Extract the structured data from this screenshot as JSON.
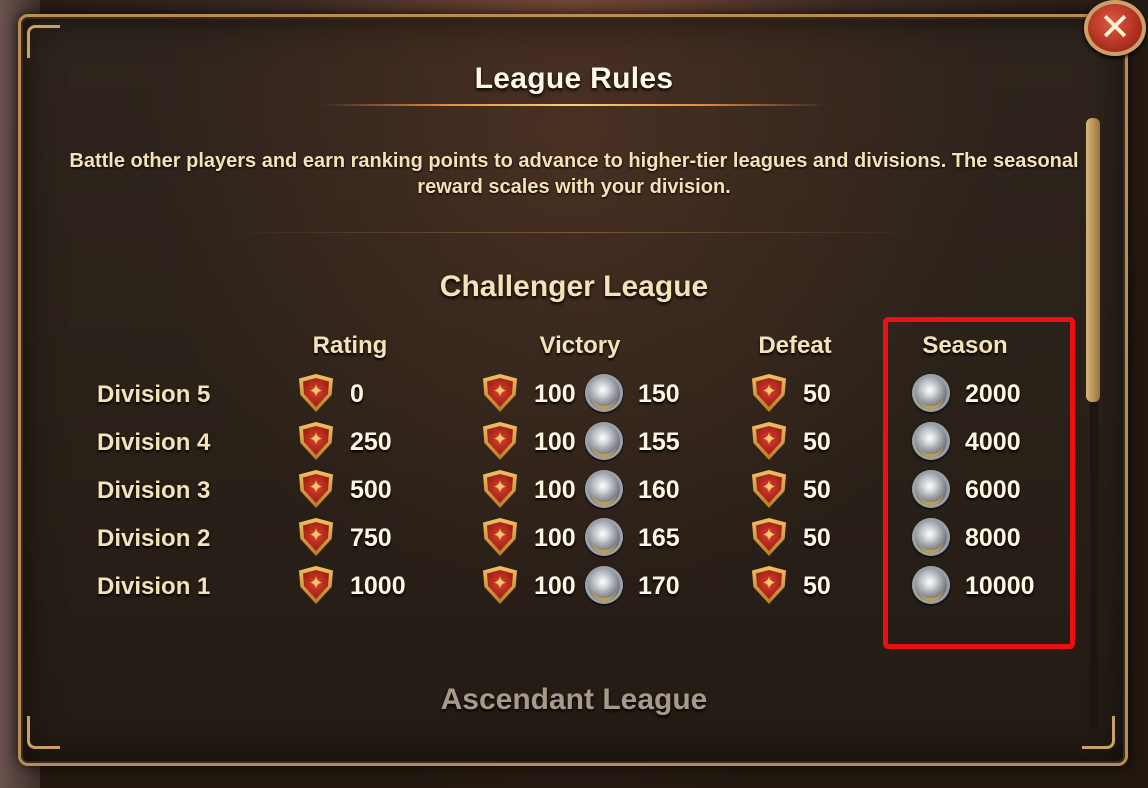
{
  "dialog": {
    "title": "League Rules",
    "description": "Battle other players and earn ranking points to advance to higher-tier leagues and divisions. The seasonal reward scales with your division.",
    "close_icon": "close-icon"
  },
  "league": {
    "name": "Challenger League",
    "columns": {
      "rating": "Rating",
      "victory": "Victory",
      "defeat": "Defeat",
      "season": "Season"
    },
    "rows": [
      {
        "division": "Division 5",
        "rating": "0",
        "victory_points": "100",
        "victory_coins": "150",
        "defeat": "50",
        "season": "2000"
      },
      {
        "division": "Division 4",
        "rating": "250",
        "victory_points": "100",
        "victory_coins": "155",
        "defeat": "50",
        "season": "4000"
      },
      {
        "division": "Division 3",
        "rating": "500",
        "victory_points": "100",
        "victory_coins": "160",
        "defeat": "50",
        "season": "6000"
      },
      {
        "division": "Division 2",
        "rating": "750",
        "victory_points": "100",
        "victory_coins": "165",
        "defeat": "50",
        "season": "8000"
      },
      {
        "division": "Division 1",
        "rating": "1000",
        "victory_points": "100",
        "victory_coins": "170",
        "defeat": "50",
        "season": "10000"
      }
    ]
  },
  "next_league": {
    "name": "Ascendant League"
  },
  "icons": {
    "rating": "shield-star-icon",
    "coin": "silver-medal-icon"
  },
  "colors": {
    "accent": "#b88c52",
    "highlight": "#ee0f14",
    "text": "#f4e2b8"
  }
}
